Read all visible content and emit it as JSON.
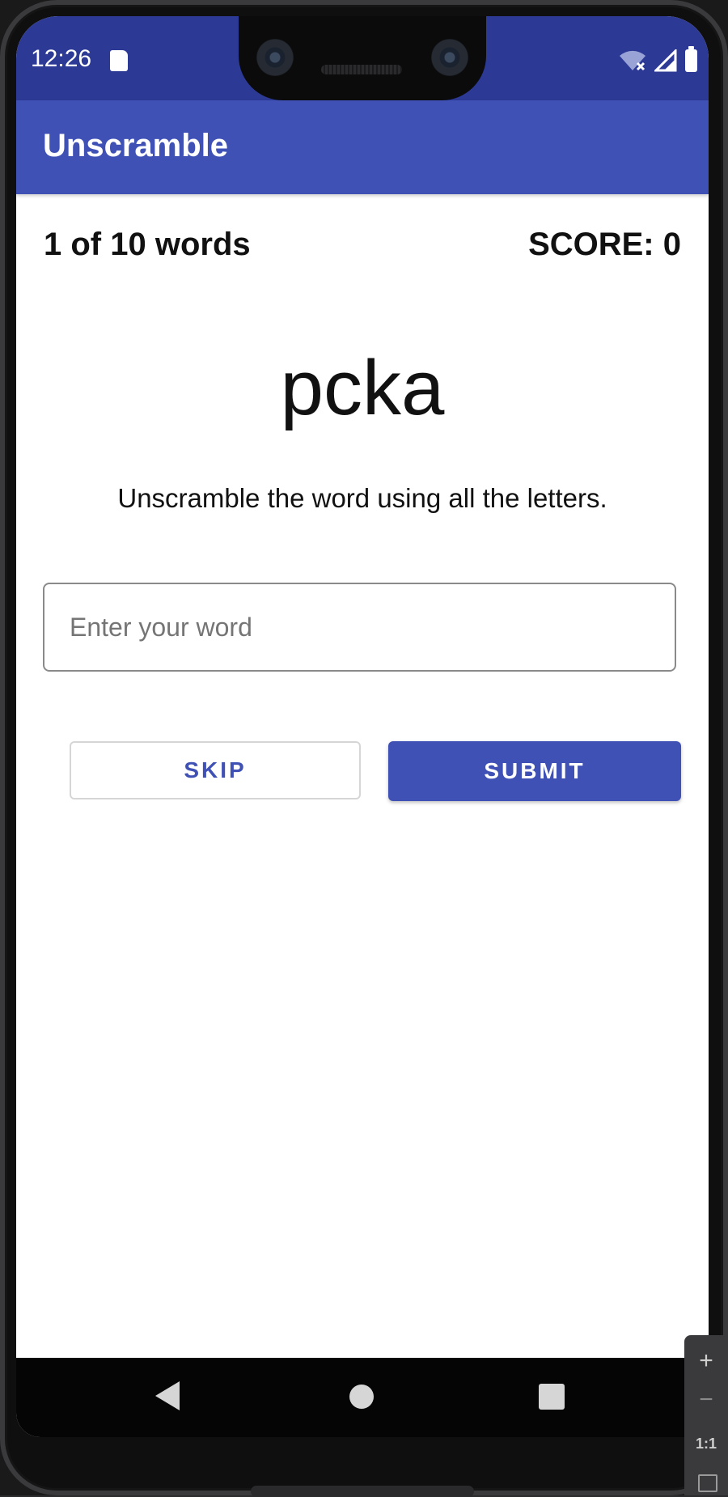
{
  "status_bar": {
    "time": "12:26"
  },
  "app_bar": {
    "title": "Unscramble"
  },
  "game": {
    "word_count": "1 of 10 words",
    "score": "SCORE: 0",
    "scrambled_word": "pcka",
    "instructions": "Unscramble the word using all the letters."
  },
  "input": {
    "placeholder": "Enter your word",
    "value": ""
  },
  "buttons": {
    "skip_label": "SKIP",
    "submit_label": "SUBMIT"
  },
  "emulator_controls": {
    "zoom_in": "+",
    "zoom_out": "−",
    "actual_size": "1:1"
  },
  "colors": {
    "primary": "#3f51b5",
    "primary_dark": "#2c3a96",
    "text": "#111111"
  }
}
